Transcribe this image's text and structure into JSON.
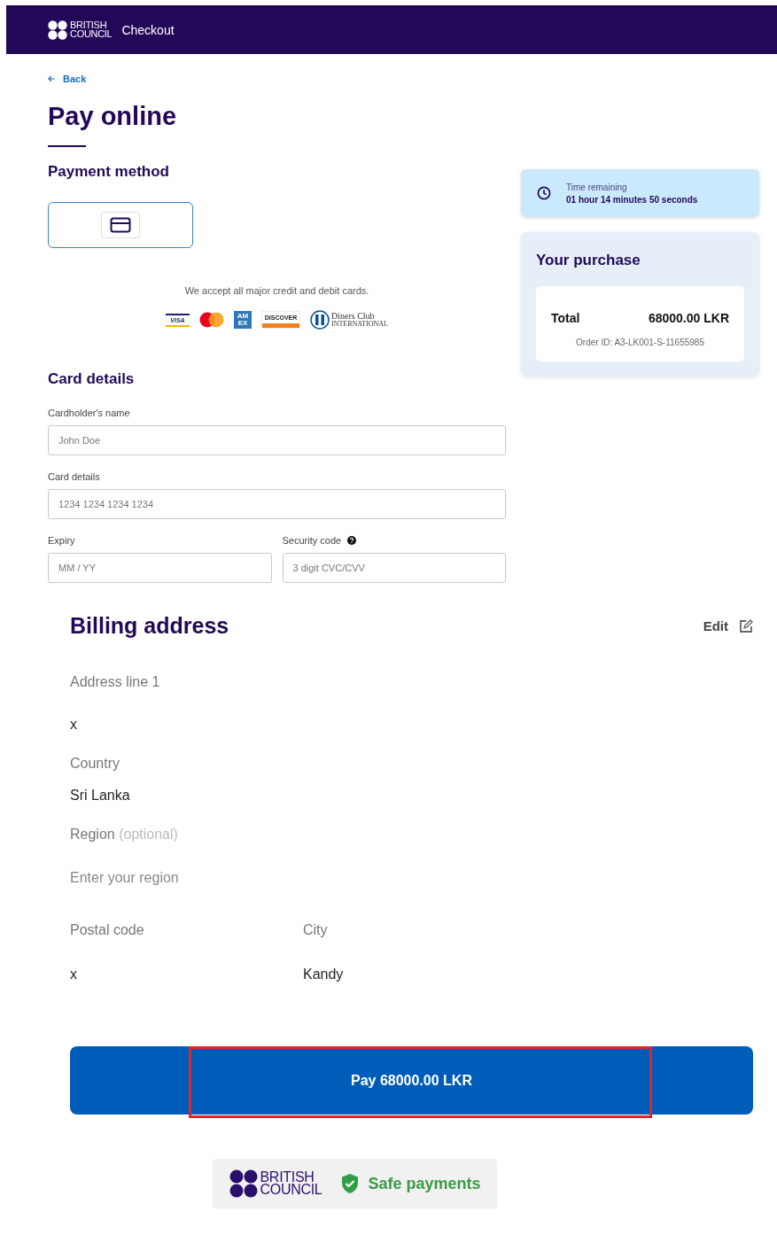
{
  "header": {
    "logo": [
      "BRITISH",
      "COUNCIL"
    ],
    "title": "Checkout"
  },
  "back": "Back",
  "title": "Pay online",
  "payment_method": {
    "heading": "Payment method",
    "options": [
      {
        "kind": "card",
        "selected": true
      }
    ],
    "accept_text": "We accept all major credit and debit cards.",
    "brands": [
      {
        "kind": "visa",
        "text": [
          "VISA"
        ]
      },
      {
        "kind": "mastercard"
      },
      {
        "kind": "amex",
        "text": [
          "AM",
          "EX"
        ]
      },
      {
        "kind": "discover",
        "text": [
          "DISCOVER"
        ]
      },
      {
        "kind": "diners",
        "text": [
          "Diners Club",
          "INTERNATIONAL"
        ]
      }
    ]
  },
  "card_details": {
    "heading": "Card details",
    "rows": [
      [
        {
          "label": "Cardholder's name",
          "placeholder": "John Doe",
          "help": false
        }
      ],
      [
        {
          "label": "Card details",
          "placeholder": "1234 1234 1234 1234",
          "help": false
        }
      ],
      [
        {
          "label": "Expiry",
          "placeholder": "MM / YY",
          "help": false
        },
        {
          "label": "Security code",
          "placeholder": "3 digit CVC/CVV",
          "help": true
        }
      ]
    ]
  },
  "timer": {
    "label": "Time remaining",
    "value": "01 hour 14 minutes 50 seconds"
  },
  "purchase": {
    "heading": "Your purchase",
    "total_label": "Total",
    "total": "68000.00 LKR",
    "order_id": "Order ID: A3-LK001-S-11655985"
  },
  "billing": {
    "heading": "Billing address",
    "edit": "Edit",
    "rows": [
      [
        {
          "label": "Address line 1",
          "value": "x"
        }
      ],
      [
        {
          "label": "Country",
          "value": "Sri Lanka"
        }
      ],
      [
        {
          "label": "Region",
          "optional": "(optional)",
          "placeholder": "Enter your region"
        }
      ],
      [
        {
          "label": "Postal code",
          "value": "x"
        },
        {
          "label": "City",
          "value": "Kandy"
        }
      ]
    ]
  },
  "pay_button": "Pay 68000.00 LKR",
  "footer": {
    "logo": [
      "BRITISH",
      "COUNCIL"
    ],
    "badge": "Safe payments"
  }
}
